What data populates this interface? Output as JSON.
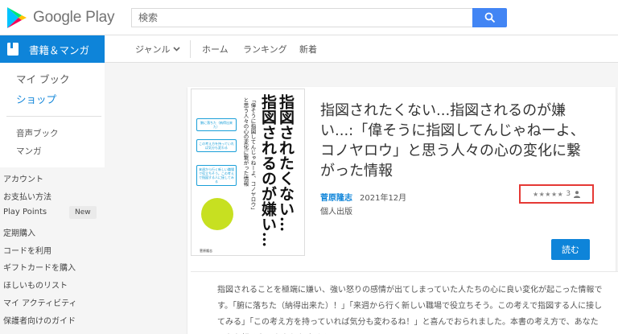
{
  "header": {
    "logo_text": "Google Play",
    "search_placeholder": "検索"
  },
  "subnav": {
    "category": "書籍＆マンガ",
    "genre": "ジャンル",
    "links": [
      "ホーム",
      "ランキング",
      "新着"
    ]
  },
  "sidebar": {
    "primary": [
      "マイ ブック",
      "ショップ"
    ],
    "secondary": [
      "音声ブック",
      "マンガ"
    ],
    "account_links": [
      "アカウント",
      "お支払い方法",
      "Play Points",
      "定期購入",
      "コードを利用",
      "ギフトカードを購入",
      "ほしいものリスト",
      "マイ アクティビティ",
      "保護者向けのガイド"
    ],
    "new_badge": "New"
  },
  "book": {
    "title": "指図されたくない...指図されるのが嫌い...:「偉そうに指図してんじゃねーよ、コノヤロウ」と思う人々の心の変化に繋がった情報",
    "author": "菅原隆志",
    "date": "2021年12月",
    "publisher": "個人出版",
    "stars": "★★★★★",
    "rating_count": "3",
    "read_button": "読む",
    "cover": {
      "title_line1": "指図されたくない…",
      "title_line2": "指図されるのが嫌い…",
      "subtitle_line1": "「偉そうに指図してんじゃねーよ、コノヤロウ」",
      "subtitle_line2": "と思う人々の心の変化に繋がった情報",
      "bubble1": "腑に落ちた（納得出来た）",
      "bubble2": "この考え方を持っていれば気分も変わる",
      "bubble3": "来週から行く新しい職場で役立ちそう。この考えで指図する人に接してみる",
      "author": "菅原隆志"
    },
    "description": "指図されることを極端に嫌い、強い怒りの感情が出てしまっていた人たちの心に良い変化が起こった情報です。「腑に落ちた（納得出来た）！」「来週から行く新しい職場で役立ちそう。この考えで指図する人に接してみる」「この考え方を持っていれば気分も変わるね！」と喜んでおられました。本書の考え方で、あなたの心も軽くなるかもしれません。"
  },
  "colors": {
    "accent": "#0e84d9",
    "search_button": "#4285f4",
    "highlight": "#e53935"
  }
}
